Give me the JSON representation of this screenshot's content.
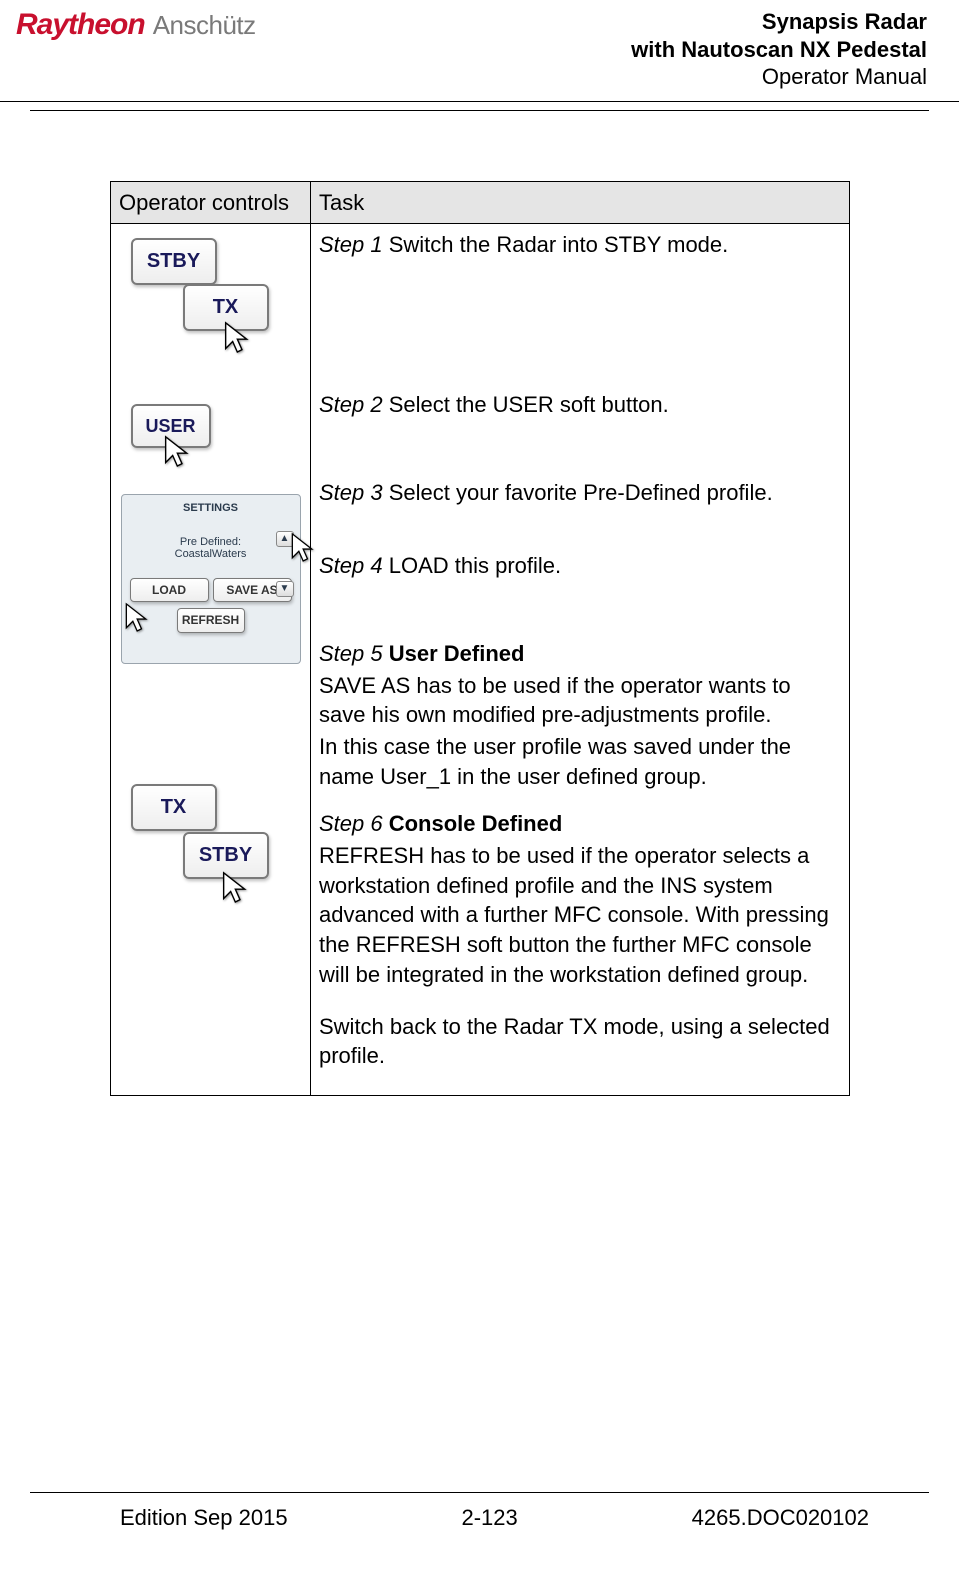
{
  "header": {
    "logo_primary": "Raytheon",
    "logo_secondary": "Anschütz",
    "title_line1": "Synapsis Radar",
    "title_line2": "with Nautoscan NX Pedestal",
    "title_line3": "Operator Manual"
  },
  "table": {
    "col_controls": "Operator controls",
    "col_task": "Task"
  },
  "controls": {
    "stby": "STBY",
    "tx": "TX",
    "user": "USER",
    "settings_title": "SETTINGS",
    "profile_label": "Pre Defined:",
    "profile_name": "CoastalWaters",
    "load": "LOAD",
    "save_as": "SAVE AS",
    "refresh": "REFRESH",
    "arrow_up": "▲",
    "arrow_down": "▼"
  },
  "steps": {
    "s1_label": "Step 1",
    "s1_text": " Switch the Radar into STBY mode.",
    "s2_label": "Step 2",
    "s2_text": " Select the USER soft button.",
    "s3_label": "Step 3",
    "s3_text": " Select your favorite Pre-Defined profile.",
    "s4_label": "Step 4",
    "s4_text": " LOAD this profile.",
    "s5_label": "Step 5",
    "s5_bold": " User Defined",
    "s5_body1": "SAVE AS has to be used if the operator wants to save his own modified pre-adjustments profile.",
    "s5_body2": "In this case the user profile was saved under the name User_1 in the user defined group.",
    "s6_label": "Step 6",
    "s6_bold": " Console Defined",
    "s6_body": "REFRESH has to be used if the operator selects a workstation defined profile and the INS system advanced with a further MFC console. With pressing the REFRESH soft button the further MFC console will be integrated in the workstation defined group.",
    "final": "Switch back to the Radar TX mode, using a selected profile."
  },
  "footer": {
    "edition": "Edition Sep 2015",
    "page": "2-123",
    "docnum": "4265.DOC020102"
  }
}
